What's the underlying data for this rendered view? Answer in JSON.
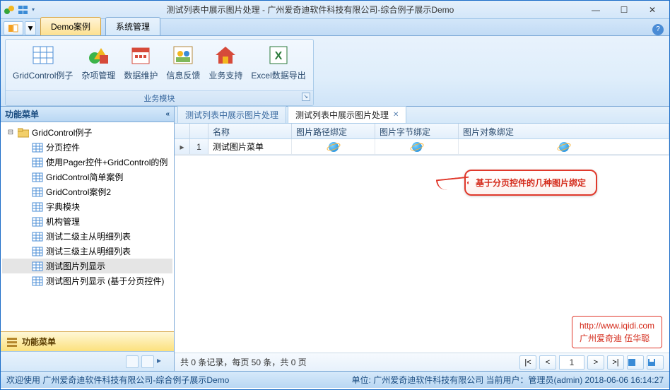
{
  "window": {
    "title": "测试列表中展示图片处理 - 广州爱奇迪软件科技有限公司-综合例子展示Demo"
  },
  "menu_tabs": {
    "active": "Demo案例",
    "inactive": "系统管理"
  },
  "ribbon": {
    "group_title": "业务模块",
    "items": [
      "GridControl例子",
      "杂项管理",
      "数据维护",
      "信息反馈",
      "业务支持",
      "Excel数据导出"
    ]
  },
  "side": {
    "title": "功能菜单",
    "button": "功能菜单",
    "tree": {
      "root": "GridControl例子",
      "children": [
        "分页控件",
        "使用Pager控件+GridControl的例",
        "GridControl简单案例",
        "GridControl案例2",
        "字典模块",
        "机构管理",
        "测试二级主从明细列表",
        "测试三级主从明细列表",
        "测试图片列显示",
        "测试图片列显示 (基于分页控件)"
      ],
      "selected_index": 8
    }
  },
  "doctabs": [
    {
      "label": "测试列表中展示图片处理",
      "active": false
    },
    {
      "label": "测试列表中展示图片处理",
      "active": true
    }
  ],
  "grid": {
    "columns": [
      "名称",
      "图片路径绑定",
      "图片字节绑定",
      "图片对象绑定"
    ],
    "row": {
      "idx": "1",
      "name": "测试图片菜单"
    }
  },
  "callout": "基于分页控件的几种图片绑定",
  "watermark": {
    "url": "http://www.iqidi.com",
    "line2": "广州爱奇迪 伍华聪"
  },
  "pager": {
    "summary": "共 0 条记录，每页 50 条，共 0 页",
    "page": "1"
  },
  "status": {
    "left": "欢迎使用 广州爱奇迪软件科技有限公司-综合例子展示Demo",
    "right": "单位: 广州爱奇迪软件科技有限公司 当前用户：管理员(admin)  2018-06-06 16:14:27"
  }
}
